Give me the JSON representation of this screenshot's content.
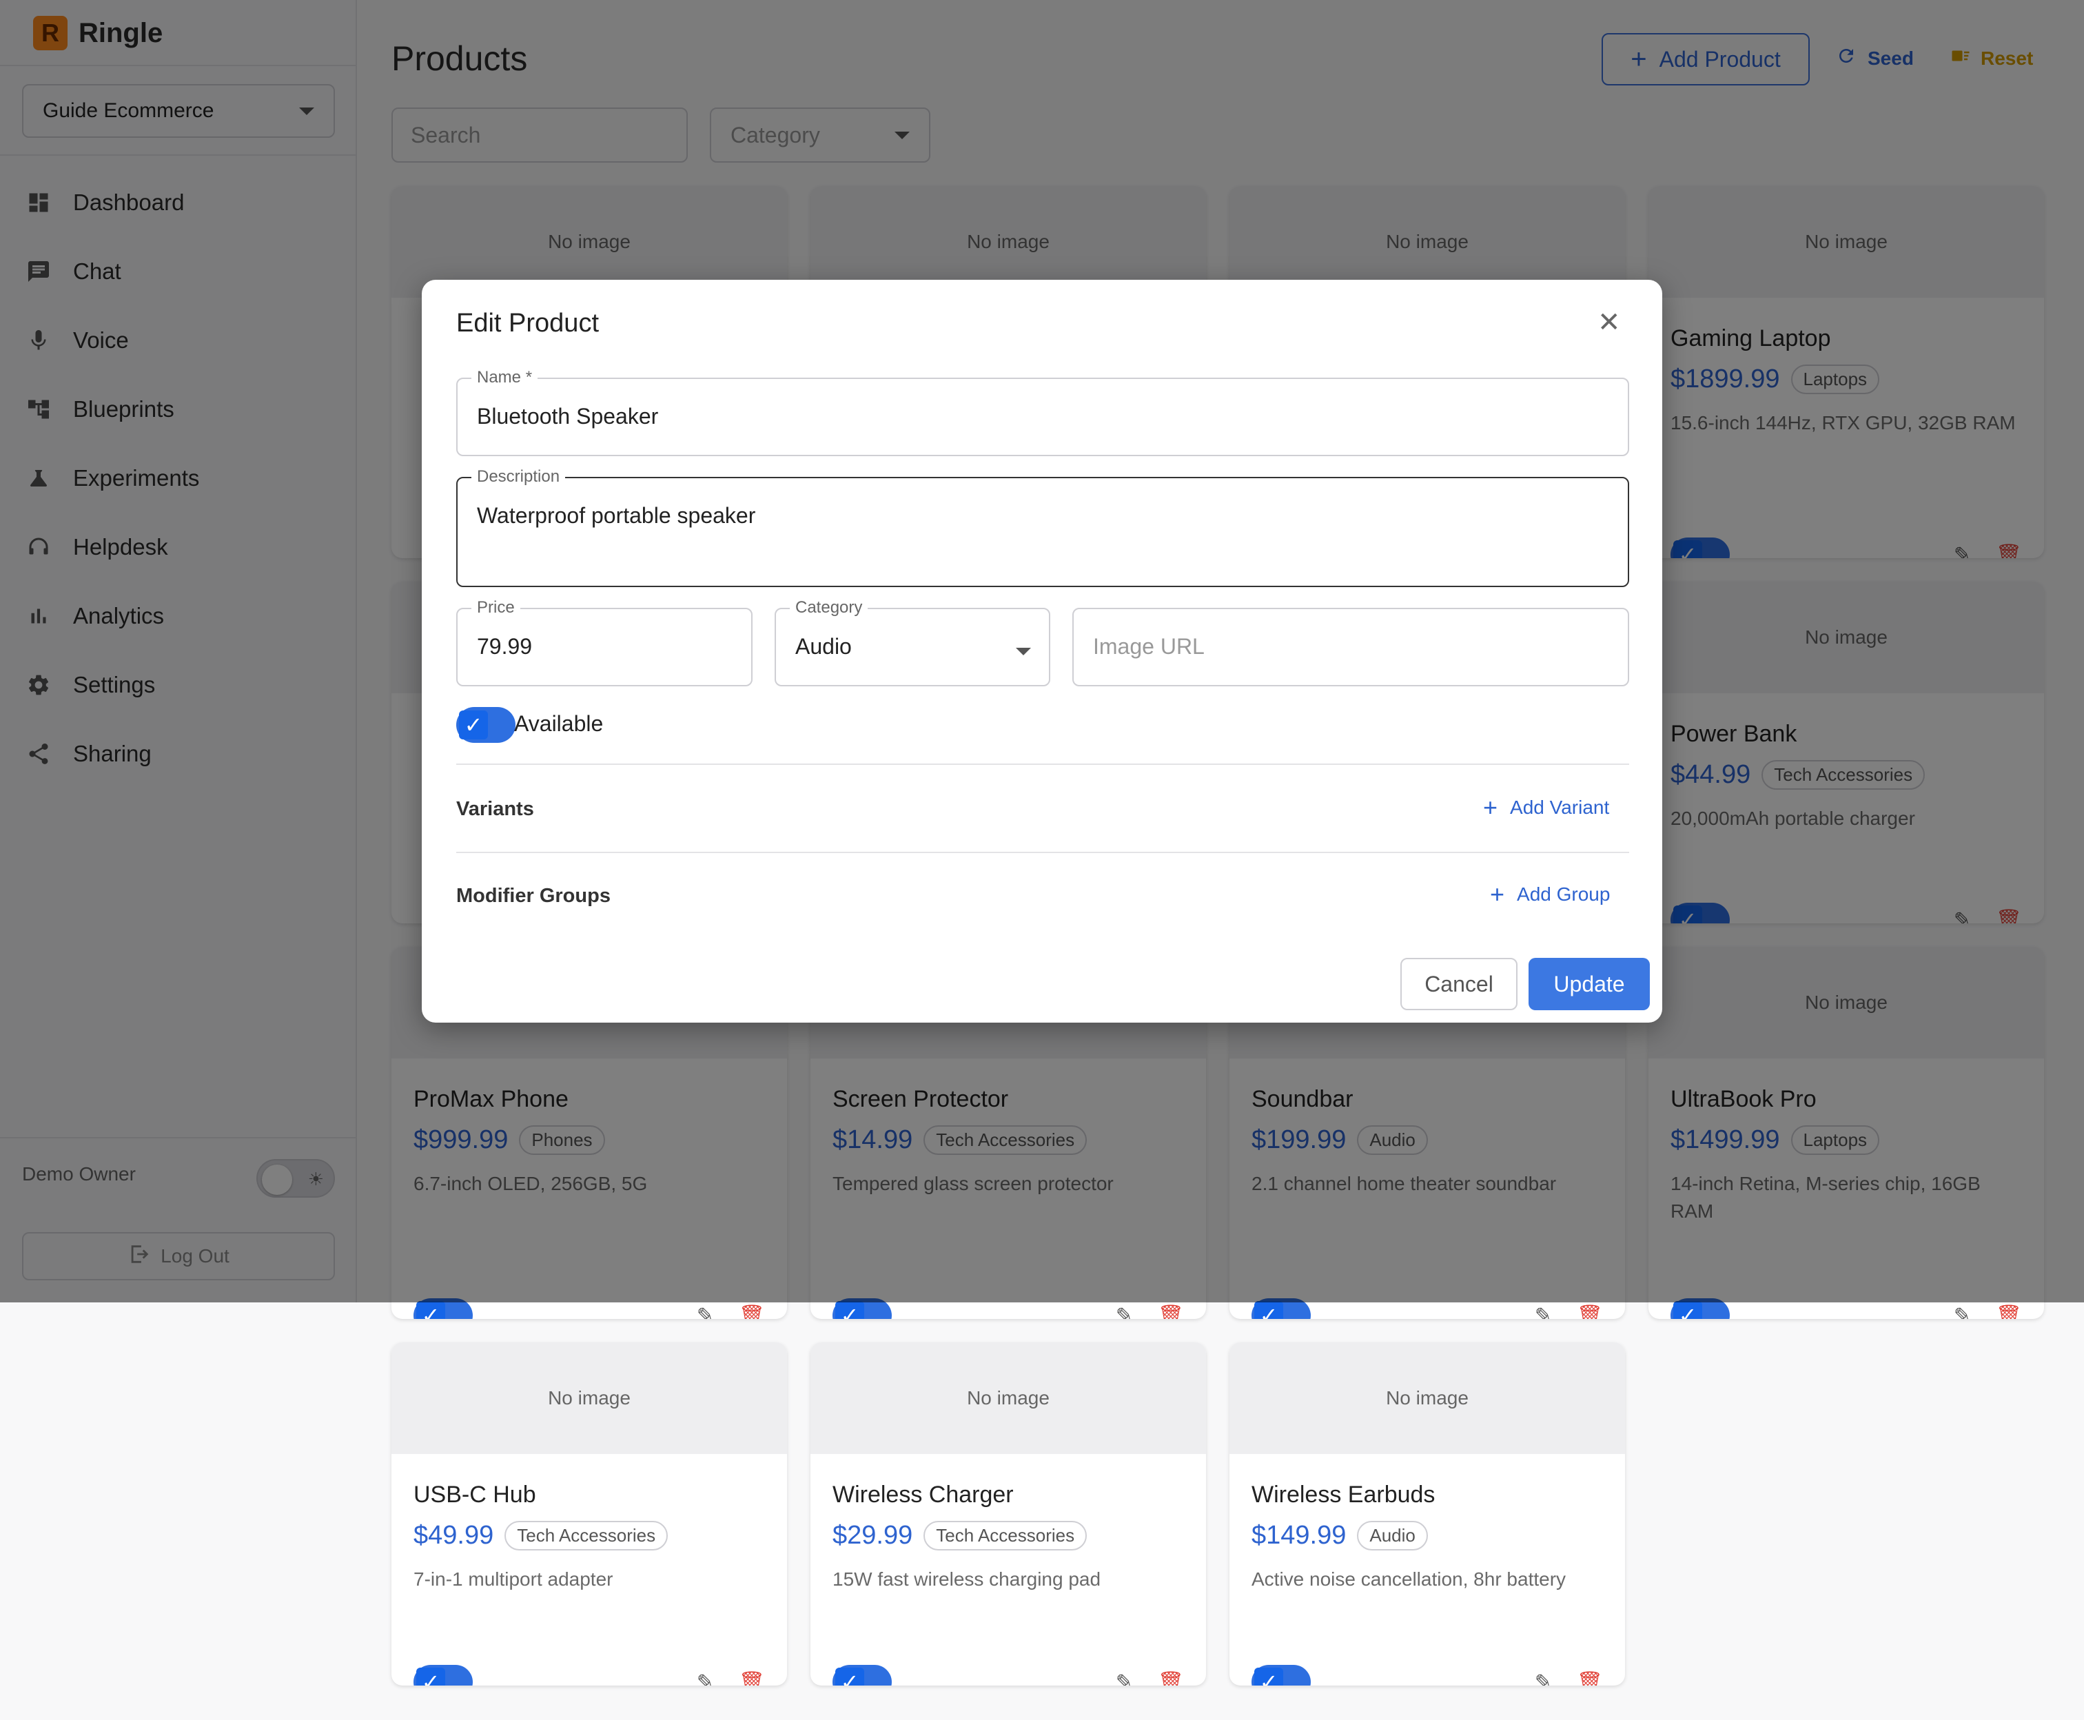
{
  "brand": {
    "name": "Ringle",
    "logo_letter": "R"
  },
  "workspace": {
    "selected": "Guide Ecommerce"
  },
  "nav": [
    {
      "label": "Dashboard",
      "icon": "dashboard-icon"
    },
    {
      "label": "Chat",
      "icon": "chat-icon"
    },
    {
      "label": "Voice",
      "icon": "microphone-icon"
    },
    {
      "label": "Blueprints",
      "icon": "blueprint-icon"
    },
    {
      "label": "Experiments",
      "icon": "flask-icon"
    },
    {
      "label": "Helpdesk",
      "icon": "headset-icon"
    },
    {
      "label": "Analytics",
      "icon": "bar-chart-icon"
    },
    {
      "label": "Settings",
      "icon": "gear-icon"
    },
    {
      "label": "Sharing",
      "icon": "share-icon"
    }
  ],
  "footer": {
    "user": "Demo Owner",
    "logout": "Log Out"
  },
  "header": {
    "title": "Products",
    "add_label": "Add Product",
    "seed_label": "Seed",
    "reset_label": "Reset"
  },
  "filters": {
    "search_placeholder": "Search",
    "category_placeholder": "Category"
  },
  "no_image": "No image",
  "products": [
    {
      "name": "Gaming Laptop",
      "price": "$1899.99",
      "category": "Laptops",
      "desc": "15.6-inch 144Hz, RTX GPU, 32GB RAM"
    },
    {
      "name": "Power Bank",
      "price": "$44.99",
      "category": "Tech Accessories",
      "desc": "20,000mAh portable charger"
    },
    {
      "name": "ProMax Phone",
      "price": "$999.99",
      "category": "Phones",
      "desc": "6.7-inch OLED, 256GB, 5G"
    },
    {
      "name": "Screen Protector",
      "price": "$14.99",
      "category": "Tech Accessories",
      "desc": "Tempered glass screen protector"
    },
    {
      "name": "Soundbar",
      "price": "$199.99",
      "category": "Audio",
      "desc": "2.1 channel home theater soundbar"
    },
    {
      "name": "UltraBook Pro",
      "price": "$1499.99",
      "category": "Laptops",
      "desc": "14-inch Retina, M-series chip, 16GB RAM"
    },
    {
      "name": "USB-C Hub",
      "price": "$49.99",
      "category": "Tech Accessories",
      "desc": "7-in-1 multiport adapter"
    },
    {
      "name": "Wireless Charger",
      "price": "$29.99",
      "category": "Tech Accessories",
      "desc": "15W fast wireless charging pad"
    },
    {
      "name": "Wireless Earbuds",
      "price": "$149.99",
      "category": "Audio",
      "desc": "Active noise cancellation, 8hr battery"
    }
  ],
  "modal": {
    "title": "Edit Product",
    "name_label": "Name *",
    "name_value": "Bluetooth Speaker",
    "description_label": "Description",
    "description_value": "Waterproof portable speaker",
    "price_label": "Price",
    "price_value": "79.99",
    "category_label": "Category",
    "category_value": "Audio",
    "image_url_placeholder": "Image URL",
    "available_label": "Available",
    "available": true,
    "variants_title": "Variants",
    "add_variant": "Add Variant",
    "modifier_title": "Modifier Groups",
    "add_group": "Add Group",
    "cancel": "Cancel",
    "update": "Update"
  },
  "colors": {
    "accent": "#2e63cf",
    "danger": "#e03a30",
    "reset": "#d39a00"
  }
}
